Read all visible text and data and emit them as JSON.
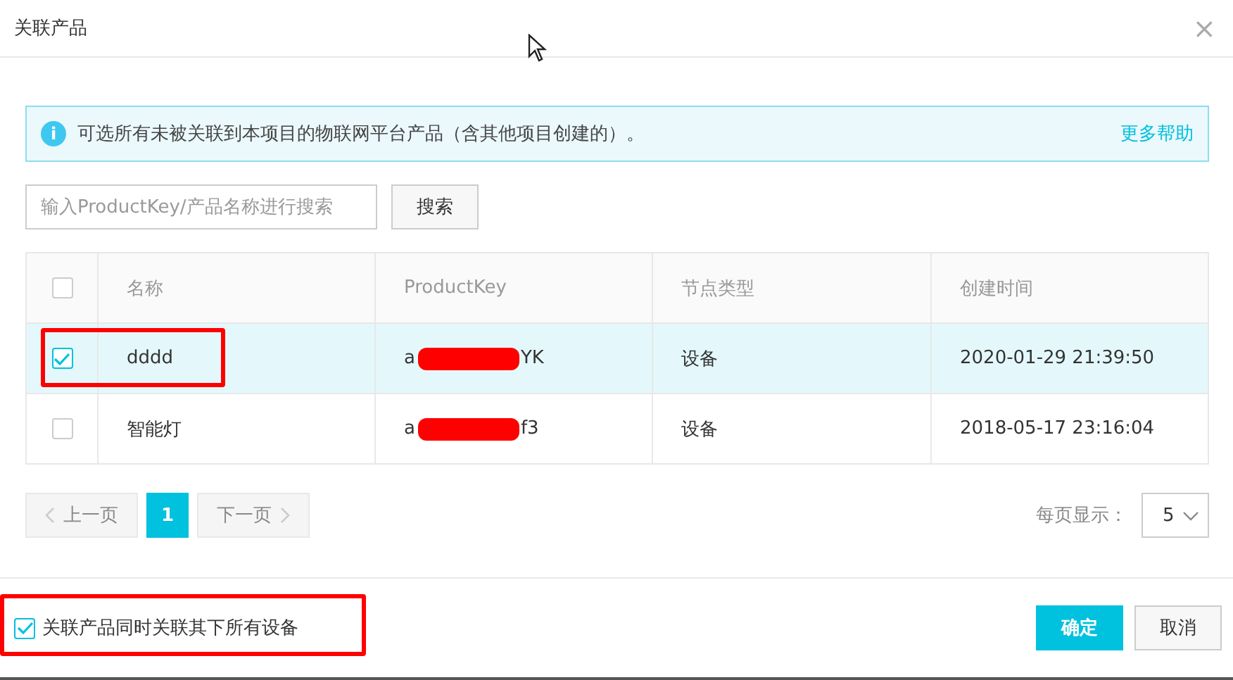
{
  "dialog": {
    "title": "关联产品",
    "close": "×"
  },
  "notice": {
    "icon": "i",
    "text": "可选所有未被关联到本项目的物联网平台产品（含其他项目创建的）。",
    "link": "更多帮助"
  },
  "search": {
    "placeholder": "输入ProductKey/产品名称进行搜索",
    "button": "搜索"
  },
  "table": {
    "select_all": {
      "checked": false
    },
    "columns": [
      "名称",
      "ProductKey",
      "节点类型",
      "创建时间"
    ],
    "rows": [
      {
        "selected": true,
        "annotated": true,
        "name": "dddd",
        "key_start": "a",
        "key_end": "YK",
        "type": "设备",
        "created": "2020-01-29 21:39:50"
      },
      {
        "selected": false,
        "annotated": false,
        "name": "智能灯",
        "key_start": "a",
        "key_end": "f3",
        "type": "设备",
        "created": "2018-05-17 23:16:04"
      }
    ]
  },
  "pagination": {
    "prev": "上一页",
    "pages": [
      {
        "label": "1",
        "selected": true
      }
    ],
    "next": "下一页",
    "page_size_label": "每页显示：",
    "page_size": "5"
  },
  "footer": {
    "option": {
      "label": "关联产品同时关联其下所有设备",
      "checked": true,
      "annotated": true
    },
    "buttons": [
      {
        "label": "确定",
        "kind": "primary"
      },
      {
        "label": "取消",
        "kind": "secondary"
      }
    ]
  }
}
